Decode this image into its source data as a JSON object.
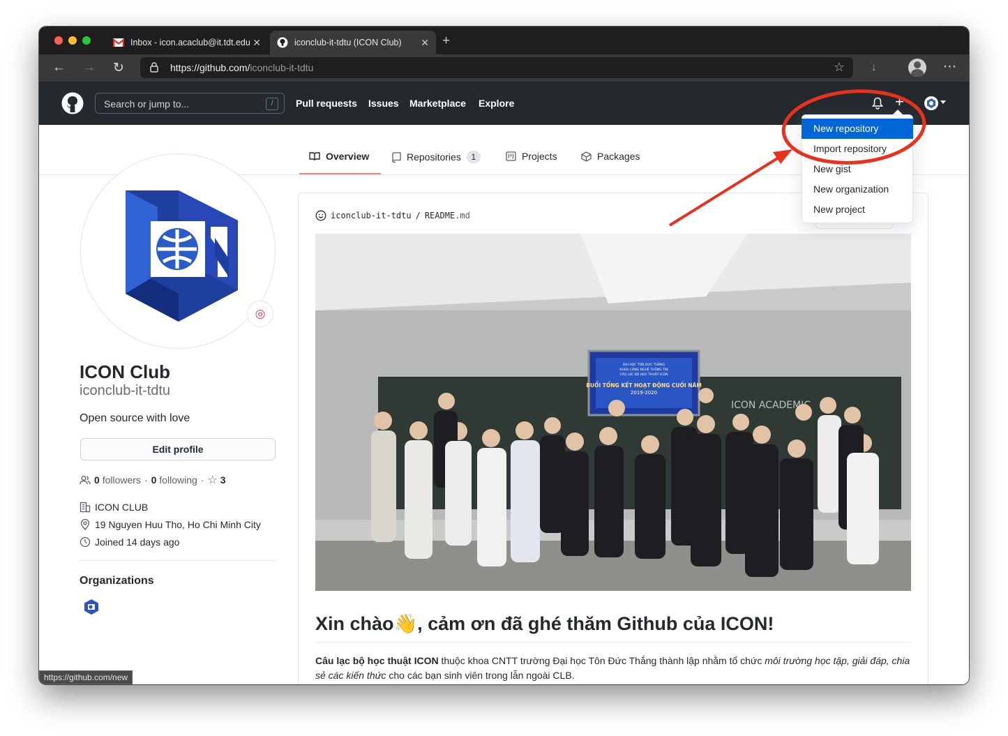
{
  "browser": {
    "tabs": [
      {
        "label": "Inbox - icon.acaclub@it.tdt.edu.vn",
        "icon": "gmail-icon",
        "active": false
      },
      {
        "label": "iconclub-it-tdtu (ICON Club)",
        "icon": "github-icon",
        "active": true
      }
    ],
    "url_host": "https://github.com/",
    "url_path": "iconclub-it-tdtu"
  },
  "header": {
    "search_placeholder": "Search or jump to...",
    "search_shortcut": "/",
    "nav": [
      "Pull requests",
      "Issues",
      "Marketplace",
      "Explore"
    ]
  },
  "create_menu": {
    "items": [
      "New repository",
      "Import repository",
      "New gist",
      "New organization",
      "New project"
    ],
    "highlighted": "New repository"
  },
  "profile_tabs": {
    "overview": "Overview",
    "repositories": "Repositories",
    "repositories_count": "1",
    "projects": "Projects",
    "packages": "Packages"
  },
  "profile": {
    "name": "ICON Club",
    "login": "iconclub-it-tdtu",
    "bio": "Open source with love",
    "edit_button": "Edit profile",
    "followers_count": "0",
    "followers_label": "followers",
    "following_count": "0",
    "following_label": "following",
    "stars": "3",
    "company": "ICON CLUB",
    "location": "19 Nguyen Huu Tho, Ho Chi Minh City",
    "joined": "Joined 14 days ago",
    "organizations_title": "Organizations",
    "status_icon": "target-icon"
  },
  "readme": {
    "path_owner": "iconclub-it-tdtu",
    "path_sep": "/",
    "path_file": "README",
    "path_ext": ".md",
    "heading": "Xin chào👋, cảm ơn đã ghé thăm Github của ICON!",
    "p_bold": "Câu lạc bộ học thuật ICON",
    "p_text1": " thuộc khoa CNTT trường Đại học Tôn Đức Thắng thành lập nhằm tổ chức ",
    "p_italic": "môi trường học tập, giải đáp, chia sẻ các kiến thức",
    "p_text2": " cho các bạn sinh viên trong lẫn ngoài CLB."
  },
  "photo": {
    "screen_line1": "ĐẠI HỌC TÔN ĐỨC THẮNG",
    "screen_line2": "KHOA CÔNG NGHỆ THÔNG TIN",
    "screen_line3": "CÂU LẠC BỘ HỌC THUẬT ICON",
    "screen_title": "BUỔI TỔNG KẾT HOẠT ĐỘNG CUỐI NĂM",
    "screen_year": "2019-2020",
    "board_text": "ICON ACADEMIC"
  },
  "status_bar_url": "https://github.com/new",
  "colors": {
    "github_header": "#24292e",
    "menu_highlight": "#0366d6",
    "annotation_red": "#e8321e",
    "tab_underline": "#f9826c"
  }
}
